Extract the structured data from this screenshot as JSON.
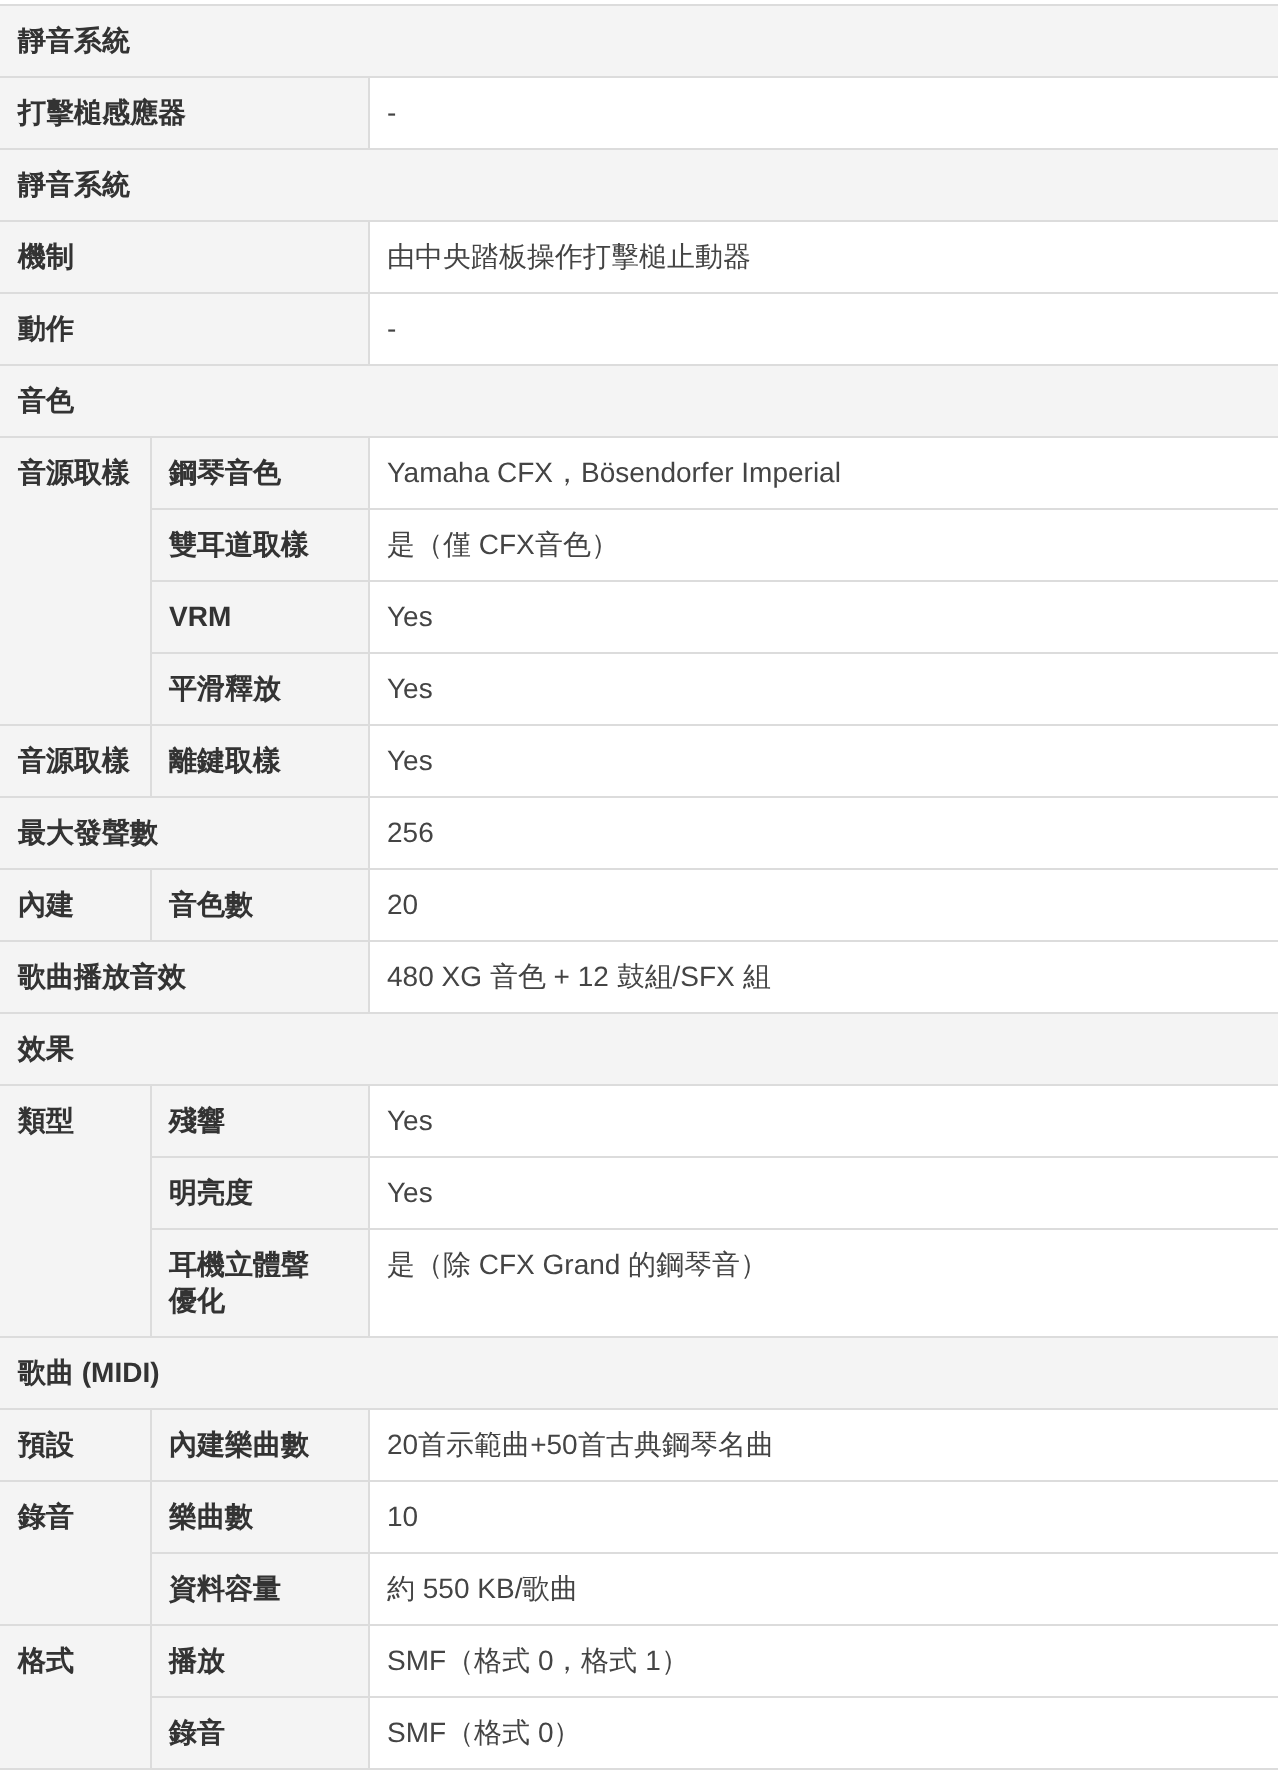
{
  "rows": [
    {
      "kind": "section",
      "label": "靜音系統"
    },
    {
      "kind": "spec",
      "label": "打擊槌感應器",
      "value": "-"
    },
    {
      "kind": "section",
      "label": "靜音系統"
    },
    {
      "kind": "spec",
      "label": "機制",
      "value": "由中央踏板操作打擊槌止動器"
    },
    {
      "kind": "spec",
      "label": "動作",
      "value": "-"
    },
    {
      "kind": "section",
      "label": "音色"
    },
    {
      "kind": "group",
      "group": "音源取樣",
      "items": [
        {
          "label": "鋼琴音色",
          "value": "Yamaha CFX，Bösendorfer Imperial"
        },
        {
          "label": "雙耳道取樣",
          "value": "是（僅 CFX音色）"
        },
        {
          "label": "VRM",
          "value": "Yes"
        },
        {
          "label": "平滑釋放",
          "value": "Yes"
        }
      ]
    },
    {
      "kind": "group",
      "group": "音源取樣",
      "items": [
        {
          "label": "離鍵取樣",
          "value": "Yes"
        }
      ]
    },
    {
      "kind": "spec",
      "label": "最大發聲數",
      "value": "256"
    },
    {
      "kind": "group",
      "group": "內建",
      "items": [
        {
          "label": "音色數",
          "value": "20"
        }
      ]
    },
    {
      "kind": "spec",
      "label": "歌曲播放音效",
      "value": "480 XG 音色 + 12 鼓組/SFX 組"
    },
    {
      "kind": "section",
      "label": "效果"
    },
    {
      "kind": "group",
      "group": "類型",
      "items": [
        {
          "label": "殘響",
          "value": "Yes"
        },
        {
          "label": "明亮度",
          "value": "Yes"
        },
        {
          "label": "耳機立體聲優化",
          "value": "是（除 CFX Grand 的鋼琴音）"
        }
      ]
    },
    {
      "kind": "section",
      "label": "歌曲 (MIDI)"
    },
    {
      "kind": "group",
      "group": "預設",
      "items": [
        {
          "label": "內建樂曲數",
          "value": "20首示範曲+50首古典鋼琴名曲"
        }
      ]
    },
    {
      "kind": "group",
      "group": "錄音",
      "items": [
        {
          "label": "樂曲數",
          "value": "10"
        },
        {
          "label": "資料容量",
          "value": "約 550 KB/歌曲"
        }
      ]
    },
    {
      "kind": "group",
      "group": "格式",
      "items": [
        {
          "label": "播放",
          "value": "SMF（格式 0，格式 1）"
        },
        {
          "label": "錄音",
          "value": "SMF（格式 0）"
        }
      ]
    }
  ]
}
